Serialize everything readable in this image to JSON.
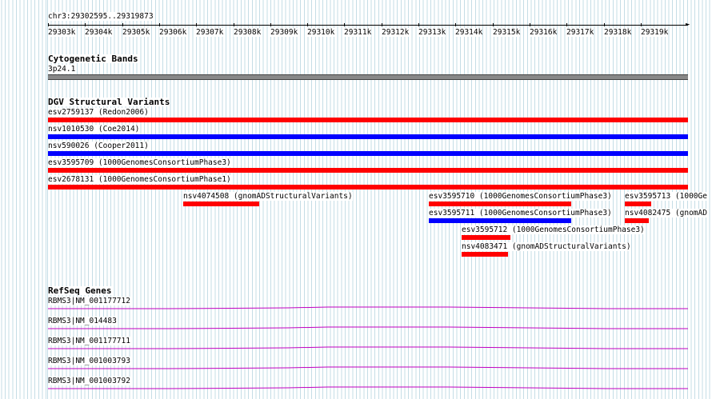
{
  "locus": "chr3:29302595..29319873",
  "ruler": [
    "29303k",
    "29304k",
    "29305k",
    "29306k",
    "29307k",
    "29308k",
    "29309k",
    "29310k",
    "29311k",
    "29312k",
    "29313k",
    "29314k",
    "29315k",
    "29316k",
    "29317k",
    "29318k",
    "29319k"
  ],
  "cytobands": {
    "title": "Cytogenetic Bands",
    "band": "3p24.1"
  },
  "dgv": {
    "title": "DGV Structural Variants",
    "full_rows": [
      {
        "label": "esv2759137 (Redon2006)",
        "color": "#ff0000"
      },
      {
        "label": "nsv1010530 (Coe2014)",
        "color": "#0000ff"
      },
      {
        "label": "nsv590026 (Cooper2011)",
        "color": "#0000ff"
      },
      {
        "label": "esv3595709 (1000GenomesConsortiumPhase3)",
        "color": "#ff0000"
      },
      {
        "label": "esv2678131 (1000GenomesConsortiumPhase1)",
        "color": "#ff0000"
      }
    ],
    "features": [
      {
        "label": "nsv4074508 (gnomADStructuralVariants)",
        "color": "#ff0000"
      },
      {
        "label": "esv3595710 (1000GenomesConsortiumPhase3)",
        "color": "#ff0000"
      },
      {
        "label": "esv3595713 (1000Ge",
        "color": "#ff0000"
      },
      {
        "label": "esv3595711 (1000GenomesConsortiumPhase3)",
        "color": "#0000ff"
      },
      {
        "label": "nsv4082475 (gnomAD",
        "color": "#ff0000"
      },
      {
        "label": "esv3595712 (1000GenomesConsortiumPhase3)",
        "color": "#ff0000"
      },
      {
        "label": "nsv4083471 (gnomADStructuralVariants)",
        "color": "#ff0000"
      }
    ]
  },
  "refseq": {
    "title": "RefSeq Genes",
    "genes": [
      "RBMS3|NM_001177712",
      "RBMS3|NM_014483",
      "RBMS3|NM_001177711",
      "RBMS3|NM_001003793",
      "RBMS3|NM_001003792"
    ],
    "color": "#c000c0"
  }
}
